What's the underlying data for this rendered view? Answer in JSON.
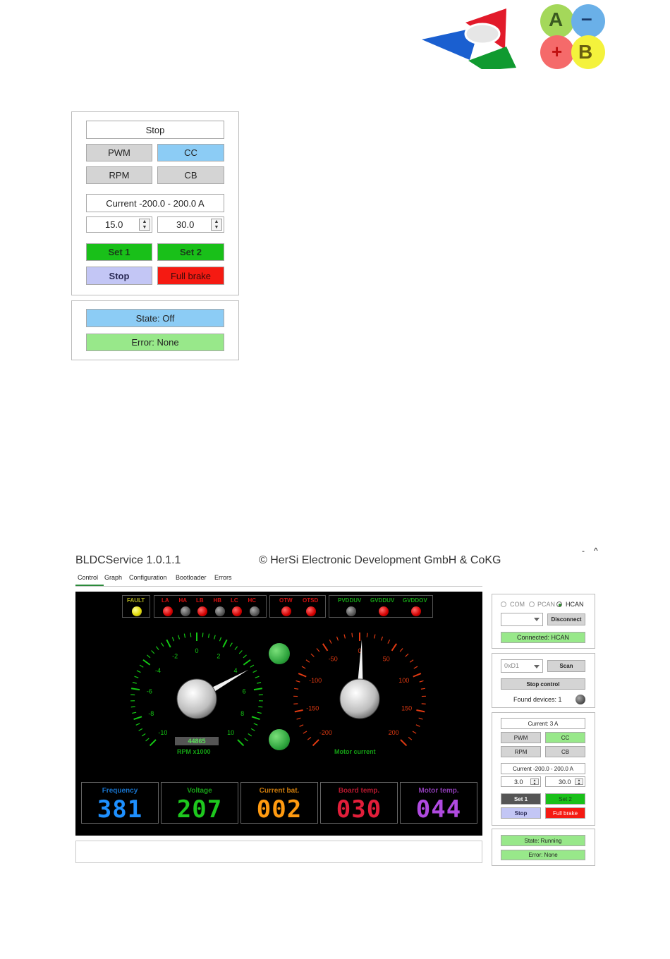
{
  "logos": {
    "abplus": {
      "a": "A",
      "minus": "–",
      "plus": "+",
      "b": "B"
    }
  },
  "top_control": {
    "stop_top": "Stop",
    "pwm": "PWM",
    "cc": "CC",
    "rpm": "RPM",
    "cb": "CB",
    "range": "Current  -200.0 - 200.0 A",
    "val1": "15.0",
    "val2": "30.0",
    "set1": "Set 1",
    "set2": "Set 2",
    "stop": "Stop",
    "full_brake": "Full brake"
  },
  "top_status": {
    "state": "State: Off",
    "error": "Error: None"
  },
  "app": {
    "title": "BLDCService 1.0.1.1",
    "copyright": "© HerSi Electronic Development GmbH & CoKG",
    "win_min": "-",
    "win_max": "^",
    "tabs": [
      "Control",
      "Graph",
      "Configuration",
      "Bootloader",
      "Errors"
    ]
  },
  "faults": {
    "fault": "FAULT",
    "group1": [
      "LA",
      "HA",
      "LB",
      "HB",
      "LC",
      "HC"
    ],
    "group1_states": [
      "red",
      "gray",
      "red",
      "gray",
      "red",
      "gray"
    ],
    "group2": [
      "OTW",
      "OTSD"
    ],
    "group3": [
      "PVDDUV",
      "GVDDUV",
      "GVDDOV"
    ],
    "group3_states": [
      "gray",
      "red",
      "red"
    ]
  },
  "rpm_gauge": {
    "ticks": [
      "-10",
      "-8",
      "-6",
      "-4",
      "-2",
      "0",
      "2",
      "4",
      "6",
      "8",
      "10"
    ],
    "readout": "44865",
    "label": "RPM x1000",
    "value": 4.4865,
    "color": "#14c814"
  },
  "current_gauge": {
    "ticks": [
      "-200",
      "-150",
      "-100",
      "-50",
      "0",
      "50",
      "100",
      "150",
      "200"
    ],
    "label": "Motor current",
    "value": 3,
    "color": "#e03a12"
  },
  "meters": [
    {
      "title": "Frequency",
      "digits": "381",
      "color": "#1e90ff"
    },
    {
      "title": "Voltage",
      "digits": "207",
      "color": "#1ec81e"
    },
    {
      "title": "Current bat.",
      "digits": "002",
      "color": "#ff9a10"
    },
    {
      "title": "Board temp.",
      "digits": "030",
      "color": "#e21e3a"
    },
    {
      "title": "Motor temp.",
      "digits": "044",
      "color": "#b04ae0"
    }
  ],
  "side": {
    "radio_com": "COM",
    "radio_pcan": "PCAN",
    "radio_hcan": "HCAN",
    "disconnect": "Disconnect",
    "connected": "Connected: HCAN",
    "address": "0xD1",
    "scan": "Scan",
    "stop_control": "Stop control",
    "found": "Found devices: 1",
    "current": "Current: 3 A",
    "pwm": "PWM",
    "cc": "CC",
    "rpm": "RPM",
    "cb": "CB",
    "range": "Current  -200.0 - 200.0 A",
    "val1": "3.0",
    "val2": "30.0",
    "set1": "Set 1",
    "set2": "Set 2",
    "stop": "Stop",
    "full_brake": "Full brake",
    "state": "State: Running",
    "error": "Error: None"
  }
}
